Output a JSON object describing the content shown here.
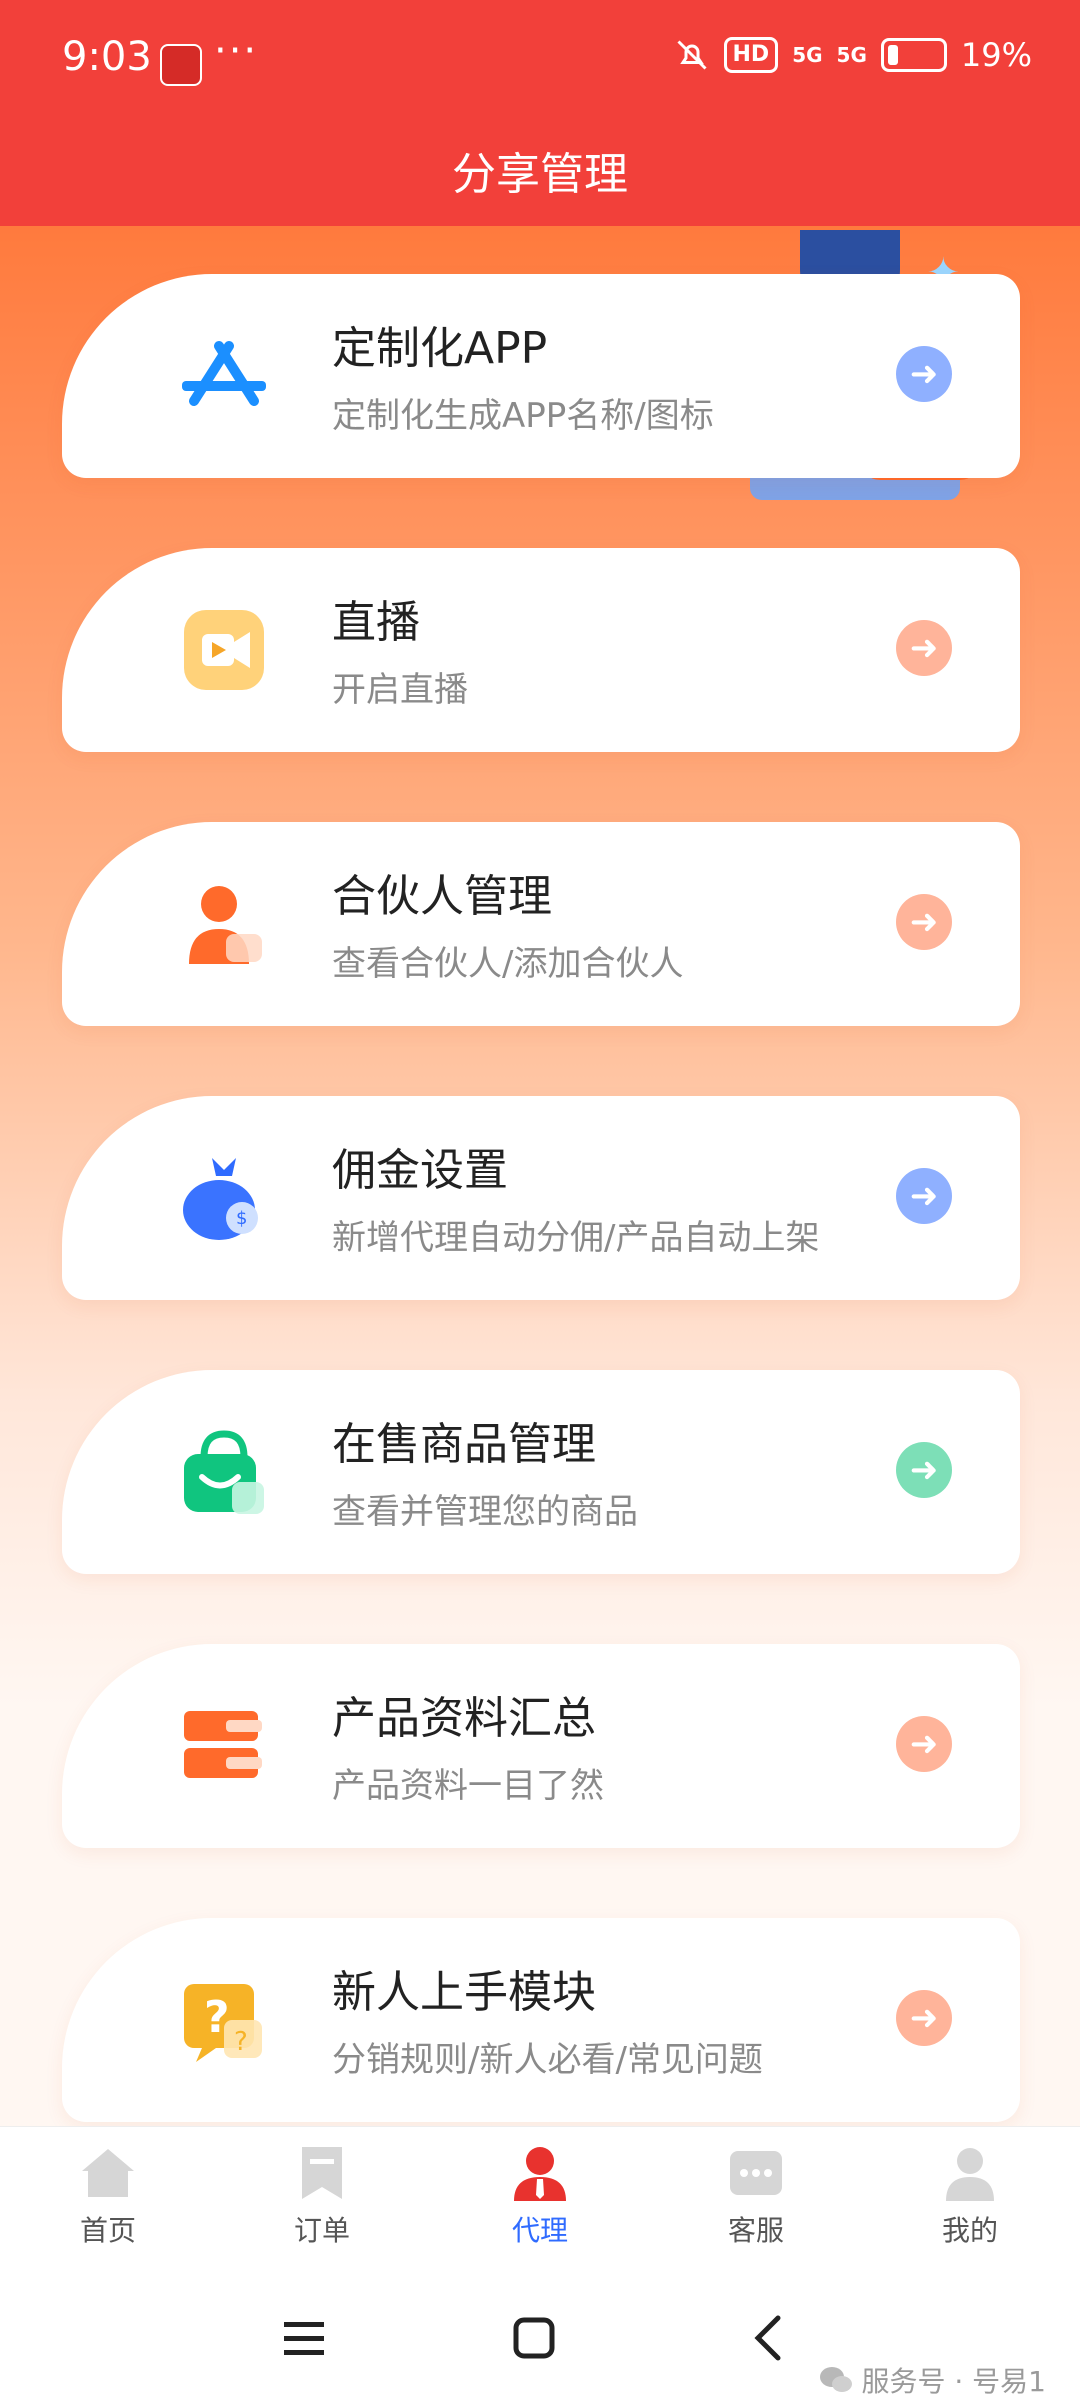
{
  "status_bar": {
    "time": "9:03",
    "dots": "···",
    "hd": "HD",
    "sig1": "5G",
    "sig2": "5G",
    "battery": "19%"
  },
  "header": {
    "title": "分享管理"
  },
  "cards": [
    {
      "title": "定制化APP",
      "subtitle": "定制化生成APP名称/图标",
      "icon": "app-store-icon",
      "arrow_color": "#8fb0ff"
    },
    {
      "title": "直播",
      "subtitle": "开启直播",
      "icon": "live-video-icon",
      "arrow_color": "#ffb49a"
    },
    {
      "title": "合伙人管理",
      "subtitle": "查看合伙人/添加合伙人",
      "icon": "partner-icon",
      "arrow_color": "#ffb49a"
    },
    {
      "title": "佣金设置",
      "subtitle": "新增代理自动分佣/产品自动上架",
      "icon": "money-bag-icon",
      "arrow_color": "#8fb0ff"
    },
    {
      "title": "在售商品管理",
      "subtitle": "查看并管理您的商品",
      "icon": "shopping-bag-icon",
      "arrow_color": "#7ddfb7"
    },
    {
      "title": "产品资料汇总",
      "subtitle": "产品资料一目了然",
      "icon": "database-icon",
      "arrow_color": "#ffb49a"
    },
    {
      "title": "新人上手模块",
      "subtitle": "分销规则/新人必看/常见问题",
      "icon": "question-icon",
      "arrow_color": "#ffb49a"
    }
  ],
  "tabbar": {
    "items": [
      {
        "label": "首页",
        "icon": "home-icon"
      },
      {
        "label": "订单",
        "icon": "order-icon"
      },
      {
        "label": "代理",
        "icon": "agent-icon",
        "active": true
      },
      {
        "label": "客服",
        "icon": "chat-icon"
      },
      {
        "label": "我的",
        "icon": "profile-icon"
      }
    ]
  },
  "watermark": "服务号 · 号易1",
  "colors": {
    "header_red": "#f2403a",
    "active_tab": "#2f6bff"
  }
}
